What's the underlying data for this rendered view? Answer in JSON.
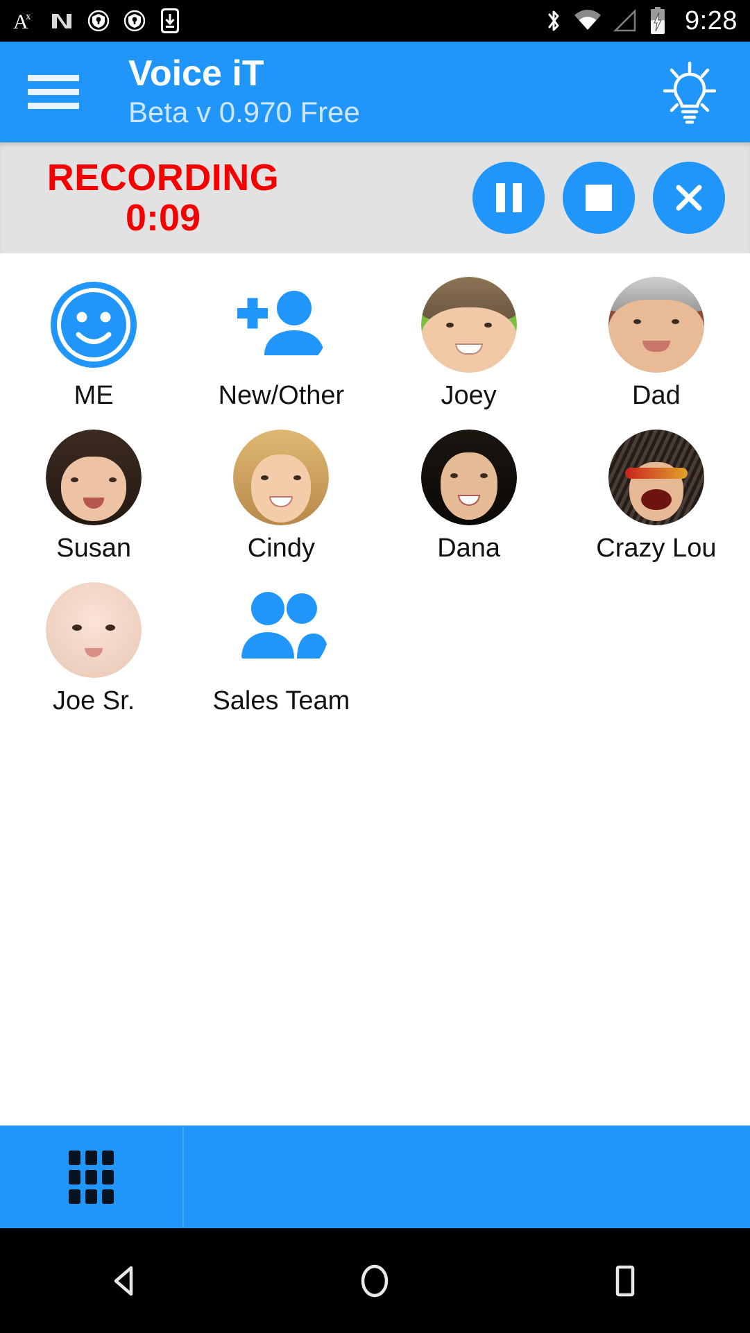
{
  "status_bar": {
    "time": "9:28",
    "left_icons": [
      {
        "name": "text-size-icon",
        "glyph": "A"
      },
      {
        "name": "nougat-n-icon",
        "glyph": "N"
      },
      {
        "name": "vpn-key-shield-icon-1",
        "glyph": "key"
      },
      {
        "name": "vpn-key-shield-icon-2",
        "glyph": "key"
      },
      {
        "name": "download-to-device-icon",
        "glyph": "download"
      }
    ],
    "right_icons": [
      {
        "name": "bluetooth-icon"
      },
      {
        "name": "wifi-icon"
      },
      {
        "name": "cell-signal-icon"
      },
      {
        "name": "battery-charging-icon"
      }
    ]
  },
  "app_bar": {
    "menu_label": "menu",
    "title": "Voice iT",
    "subtitle": "Beta v 0.970 Free",
    "tip_label": "tip"
  },
  "recording": {
    "status_label": "RECORDING",
    "timer": "0:09",
    "status_color": "#f40000",
    "buttons": [
      {
        "name": "pause-recording-button",
        "label": "Pause"
      },
      {
        "name": "stop-recording-button",
        "label": "Stop"
      },
      {
        "name": "cancel-recording-button",
        "label": "Cancel"
      }
    ]
  },
  "contacts": [
    {
      "label": "ME",
      "type": "icon",
      "icon": "smiley-face-icon"
    },
    {
      "label": "New/Other",
      "type": "icon",
      "icon": "add-person-icon"
    },
    {
      "label": "Joey",
      "type": "photo",
      "photo": "boy-green-background"
    },
    {
      "label": "Dad",
      "type": "photo",
      "photo": "older-man-glasses"
    },
    {
      "label": "Susan",
      "type": "photo",
      "photo": "woman-dark-hair"
    },
    {
      "label": "Cindy",
      "type": "photo",
      "photo": "woman-blonde-hair"
    },
    {
      "label": "Dana",
      "type": "photo",
      "photo": "woman-black-hair"
    },
    {
      "label": "Crazy Lou",
      "type": "photo",
      "photo": "person-wild-hair"
    },
    {
      "label": "Joe Sr.",
      "type": "photo",
      "photo": "baby-face"
    },
    {
      "label": "Sales Team",
      "type": "icon",
      "icon": "group-people-icon"
    }
  ],
  "bottom_bar": {
    "keypad_label": "keypad",
    "accent": "#2196fa"
  },
  "nav_bar": {
    "back_label": "Back",
    "home_label": "Home",
    "recents_label": "Recents"
  },
  "theme": {
    "primary": "#2196fa",
    "recording_bg": "#e2e2e2",
    "record_red": "#f40000"
  }
}
